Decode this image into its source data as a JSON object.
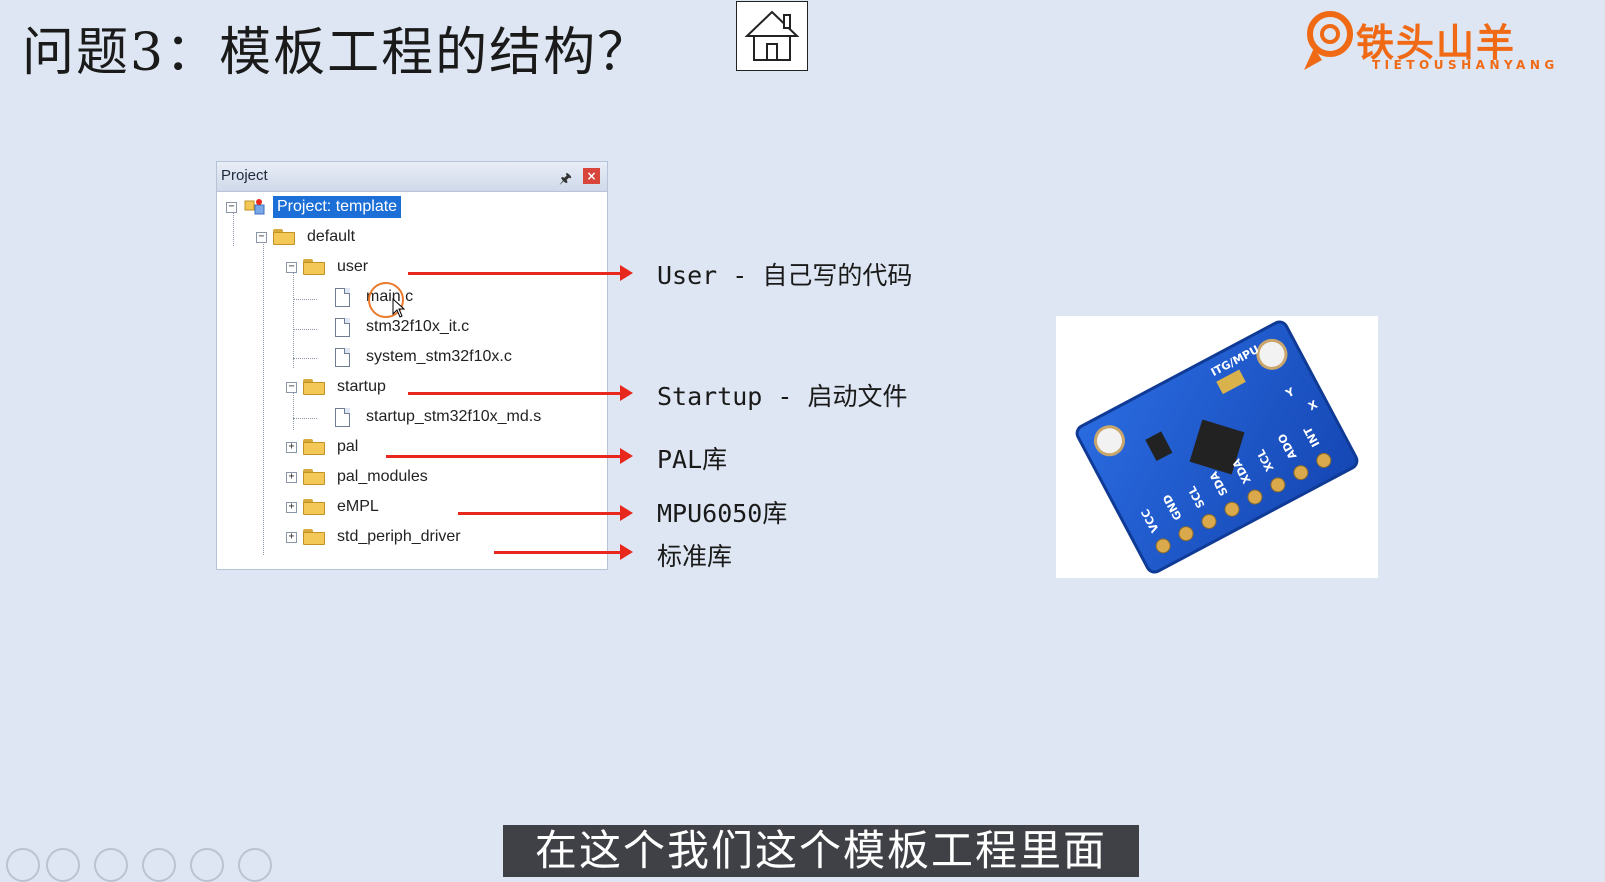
{
  "slide": {
    "title": "问题3：模板工程的结构？"
  },
  "logo": {
    "text": "铁头山羊",
    "subtext": "TIETOUSHANYANG",
    "color": "#f06a15"
  },
  "project_panel": {
    "title": "Project",
    "pin_icon": "pin-icon",
    "close_icon": "close-icon",
    "tree": [
      {
        "label": "Project: template",
        "selected": true
      },
      {
        "label": "default"
      },
      {
        "label": "user"
      },
      {
        "label": "main.c"
      },
      {
        "label": "stm32f10x_it.c"
      },
      {
        "label": "system_stm32f10x.c"
      },
      {
        "label": "startup"
      },
      {
        "label": "startup_stm32f10x_md.s"
      },
      {
        "label": "pal"
      },
      {
        "label": "pal_modules"
      },
      {
        "label": "eMPL"
      },
      {
        "label": "std_periph_driver"
      }
    ],
    "selection_color": "#1b6fd6"
  },
  "annotations": [
    {
      "text": "User - 自己写的代码"
    },
    {
      "text": "Startup - 启动文件"
    },
    {
      "text": "PAL库"
    },
    {
      "text": "MPU6050库"
    },
    {
      "text": "标准库"
    }
  ],
  "arrow_color": "#e8281c",
  "board_photo": {
    "pins": [
      "VCC",
      "GND",
      "SCL",
      "SDA",
      "XDA",
      "XCL",
      "ADO",
      "INT"
    ],
    "board_label": "ITG/MPU",
    "axis_labels": [
      "Y",
      "X"
    ],
    "board_color": "#1f5fd1"
  },
  "subtitle": "在这个我们这个模板工程里面"
}
